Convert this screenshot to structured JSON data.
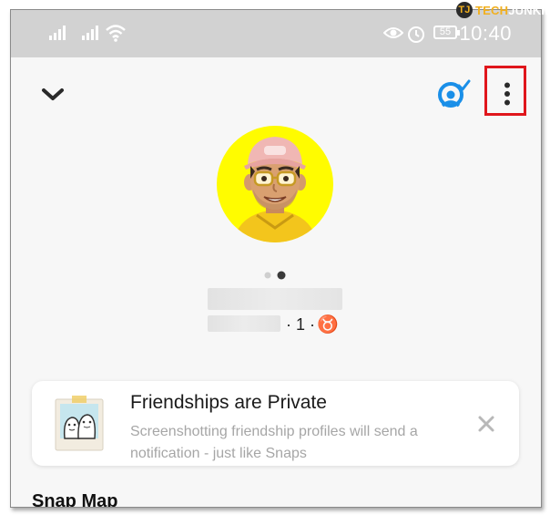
{
  "statusbar": {
    "time": "10:40",
    "battery": "55",
    "icons": [
      "signal-icon",
      "signal-icon",
      "wifi-icon",
      "eye-icon",
      "alarm-icon"
    ]
  },
  "watermark": {
    "logo": "TJ",
    "part1": "TECH",
    "part2": "JUNKIE"
  },
  "header": {
    "icons": [
      "chevron-down-icon",
      "friend-action-icon",
      "more-vertical-icon"
    ],
    "highlight_color": "#e0161c"
  },
  "profile": {
    "avatar_bg": "#fffc00",
    "stats": {
      "score": "· 1 ·",
      "zodiac": "♉"
    }
  },
  "card": {
    "title": "Friendships are Private",
    "body": "Screenshotting friendship profiles will send a notification - just like Snaps",
    "close_icon": "close-icon"
  },
  "sections": {
    "snap_map": "Snap Map"
  }
}
